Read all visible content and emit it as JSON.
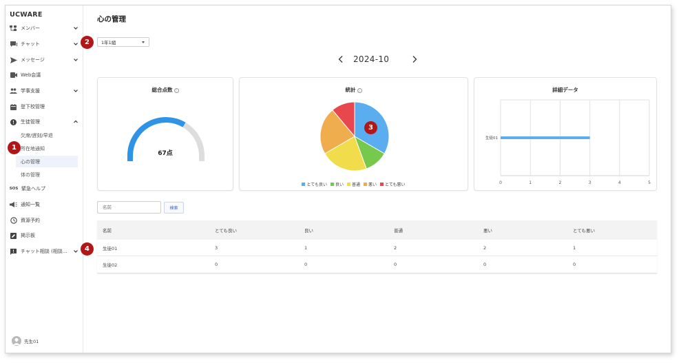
{
  "app": {
    "brand": "UCWARE"
  },
  "sidebar": {
    "items": [
      {
        "label": "メンバー",
        "icon": "org-chart-icon",
        "chevron": true
      },
      {
        "label": "チャット",
        "icon": "chat-icon",
        "chevron": true
      },
      {
        "label": "メッセージ",
        "icon": "send-icon",
        "chevron": true
      },
      {
        "label": "Web会議",
        "icon": "video-icon",
        "chevron": false
      },
      {
        "label": "学事支援",
        "icon": "group-icon",
        "chevron": true
      },
      {
        "label": "登下校管理",
        "icon": "calendar-icon",
        "chevron": false
      },
      {
        "label": "生徒管理",
        "icon": "alert-icon",
        "chevron": true
      }
    ],
    "sub_items": [
      "欠席/遅刻/早退",
      "所在地通知",
      "心の管理",
      "体の管理"
    ],
    "items_bottom": [
      {
        "label": "緊急ヘルプ",
        "icon": "sos-icon",
        "chevron": false
      },
      {
        "label": "通知一覧",
        "icon": "megaphone-icon",
        "chevron": false
      },
      {
        "label": "資源予約",
        "icon": "clock-icon",
        "chevron": false
      },
      {
        "label": "掲示板",
        "icon": "edit-icon",
        "chevron": false
      },
      {
        "label": "チャット相談 (相談...",
        "icon": "consult-icon",
        "chevron": true
      }
    ],
    "user": "先生01"
  },
  "main": {
    "title": "心の管理",
    "class_select": "1年1組",
    "month": "2024-10",
    "cards": {
      "total": {
        "title": "総合点数",
        "info": "i",
        "value": "67点"
      },
      "stats": {
        "title": "統計",
        "info": "i"
      },
      "detail": {
        "title": "詳細データ"
      }
    },
    "search": {
      "placeholder": "名前",
      "button": "検索"
    },
    "table": {
      "headers": [
        "名前",
        "とても良い",
        "良い",
        "普通",
        "悪い",
        "とても悪い"
      ],
      "rows": [
        [
          "生徒01",
          "3",
          "1",
          "2",
          "2",
          "1"
        ],
        [
          "生徒02",
          "0",
          "0",
          "0",
          "0",
          "0"
        ]
      ]
    },
    "markers": [
      "1",
      "2",
      "3",
      "4"
    ]
  },
  "colors": {
    "very_good": "#5aaef0",
    "good": "#77c94d",
    "normal": "#f1dc4c",
    "bad": "#f0ad4d",
    "very_bad": "#e8474e",
    "gauge": "#2f93e6",
    "gauge_track": "#dddddd",
    "marker": "#b31616"
  },
  "chart_data": [
    {
      "type": "gauge",
      "value": 67,
      "ylim": [
        0,
        100
      ]
    },
    {
      "type": "pie",
      "categories": [
        "とても良い",
        "良い",
        "普通",
        "悪い",
        "とても悪い"
      ],
      "values": [
        3,
        1,
        2,
        2,
        1
      ]
    },
    {
      "type": "bar",
      "orientation": "horizontal",
      "categories": [
        "生徒01"
      ],
      "values": [
        3
      ],
      "xlim": [
        0,
        5
      ],
      "xticks": [
        "0",
        "1",
        "2",
        "3",
        "4",
        "5"
      ],
      "grid": true
    }
  ]
}
